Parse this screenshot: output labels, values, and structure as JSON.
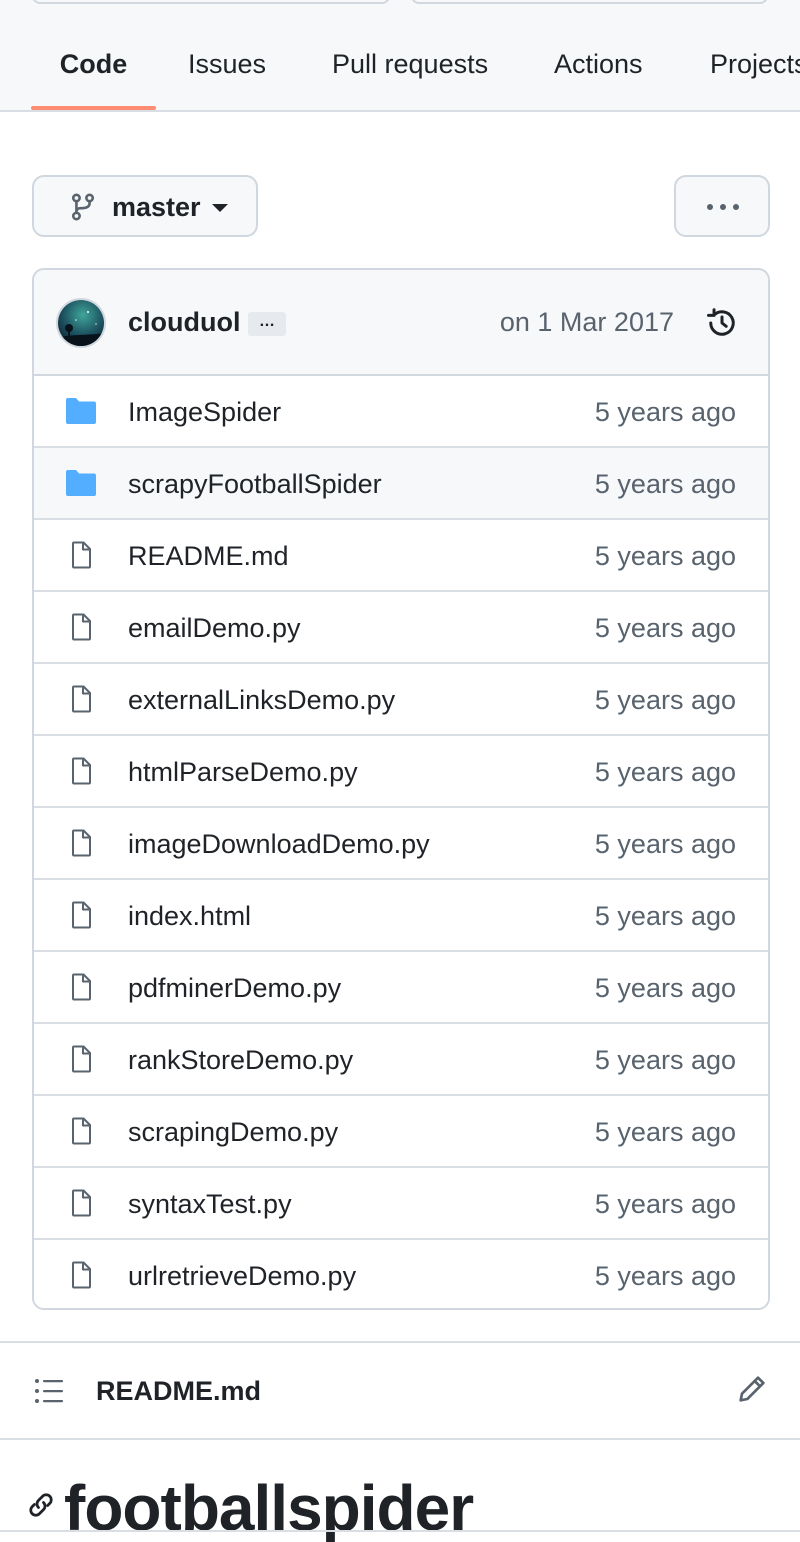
{
  "nav": {
    "tabs": [
      {
        "label": "Code",
        "active": true
      },
      {
        "label": "Issues",
        "active": false
      },
      {
        "label": "Pull requests",
        "active": false
      },
      {
        "label": "Actions",
        "active": false
      },
      {
        "label": "Projects",
        "active": false
      }
    ],
    "active_underline_color": "#fd8c73"
  },
  "branch": {
    "name": "master",
    "icon": "git-branch-icon",
    "dropdown_icon": "caret-down-icon"
  },
  "more_button_icon": "kebab-horizontal-icon",
  "latest_commit": {
    "author": "clouduol",
    "ellipsis": "…",
    "date": "on 1 Mar 2017",
    "history_icon": "history-icon"
  },
  "files": [
    {
      "name": "ImageSpider",
      "type": "folder",
      "age": "5 years ago"
    },
    {
      "name": "scrapyFootballSpider",
      "type": "folder",
      "age": "5 years ago"
    },
    {
      "name": "README.md",
      "type": "file",
      "age": "5 years ago"
    },
    {
      "name": "emailDemo.py",
      "type": "file",
      "age": "5 years ago"
    },
    {
      "name": "externalLinksDemo.py",
      "type": "file",
      "age": "5 years ago"
    },
    {
      "name": "htmlParseDemo.py",
      "type": "file",
      "age": "5 years ago"
    },
    {
      "name": "imageDownloadDemo.py",
      "type": "file",
      "age": "5 years ago"
    },
    {
      "name": "index.html",
      "type": "file",
      "age": "5 years ago"
    },
    {
      "name": "pdfminerDemo.py",
      "type": "file",
      "age": "5 years ago"
    },
    {
      "name": "rankStoreDemo.py",
      "type": "file",
      "age": "5 years ago"
    },
    {
      "name": "scrapingDemo.py",
      "type": "file",
      "age": "5 years ago"
    },
    {
      "name": "syntaxTest.py",
      "type": "file",
      "age": "5 years ago"
    },
    {
      "name": "urlretrieveDemo.py",
      "type": "file",
      "age": "5 years ago"
    }
  ],
  "colors": {
    "folder": "#54aeff",
    "file_icon": "#59636e",
    "muted_text": "#59636e",
    "border": "#d0d7de"
  },
  "readme": {
    "title": "README.md",
    "heading": "footballspider",
    "list_icon": "list-unordered-icon",
    "edit_icon": "pencil-icon",
    "anchor_icon": "link-icon"
  }
}
